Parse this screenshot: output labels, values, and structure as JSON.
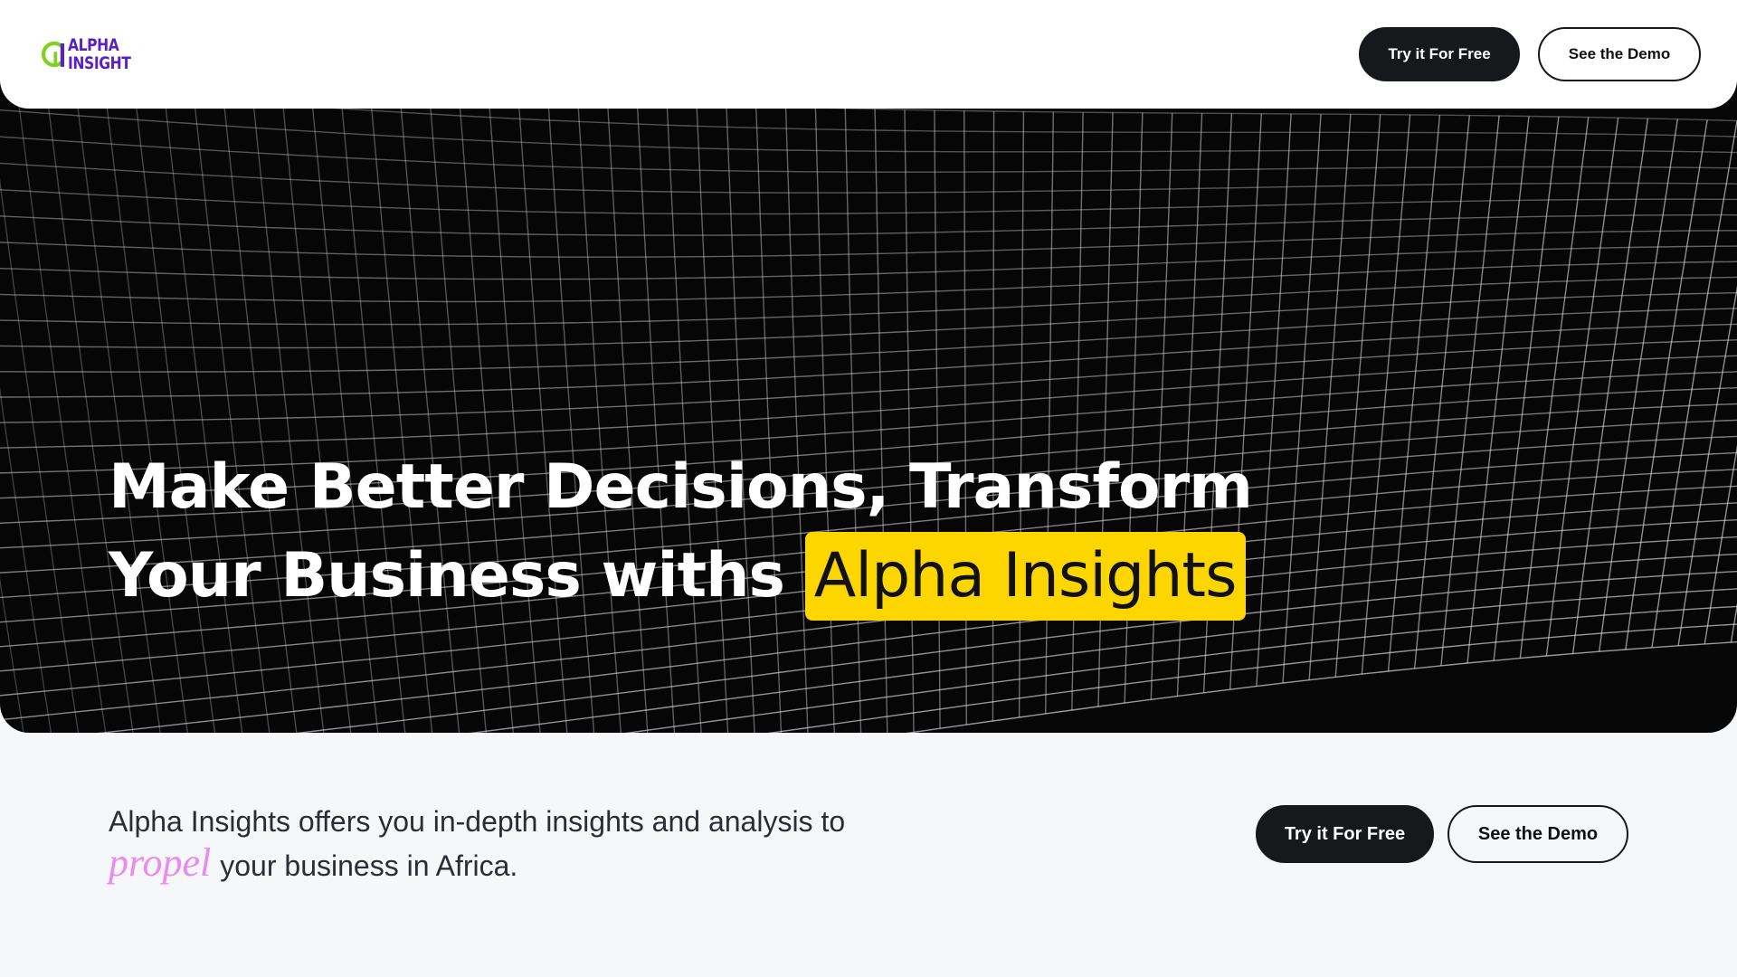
{
  "brand": {
    "logo_line1": "ALPHA",
    "logo_line2": "INSIGHT",
    "logo_text_color": "#5b1fc6",
    "logo_mark_color": "#7ed321"
  },
  "header": {
    "primary_button": "Try it For Free",
    "secondary_button": "See the Demo"
  },
  "hero": {
    "title_line1": "Make Better Decisions, Transform",
    "title_line2_prefix": "Your Business withs",
    "title_highlight": "Alpha Insights",
    "highlight_color": "#fdd600",
    "background": "#060607"
  },
  "cta": {
    "tagline_part1": "Alpha Insights offers you in-depth insights and analysis to",
    "tagline_accent": "propel",
    "tagline_part2": "your business in Africa.",
    "accent_color": "#e98bf0",
    "primary_button": "Try it For Free",
    "secondary_button": "See the Demo"
  }
}
